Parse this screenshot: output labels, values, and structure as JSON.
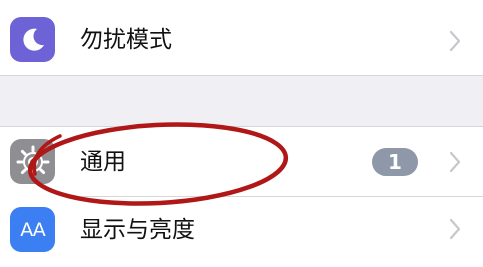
{
  "settings": {
    "items": [
      {
        "label": "勿扰模式",
        "icon": "moon-icon",
        "icon_color": "#6e63d6"
      },
      {
        "label": "通用",
        "icon": "gear-icon",
        "icon_color": "#8e8e93",
        "badge": "1"
      },
      {
        "label": "显示与亮度",
        "icon": "text-size-icon",
        "icon_color": "#3b7ff2",
        "icon_text": "AA"
      }
    ]
  },
  "colors": {
    "background": "#efeff4",
    "annotation_circle": "#b01818",
    "badge": "#8e98a8",
    "chevron": "#c7c7cc"
  }
}
